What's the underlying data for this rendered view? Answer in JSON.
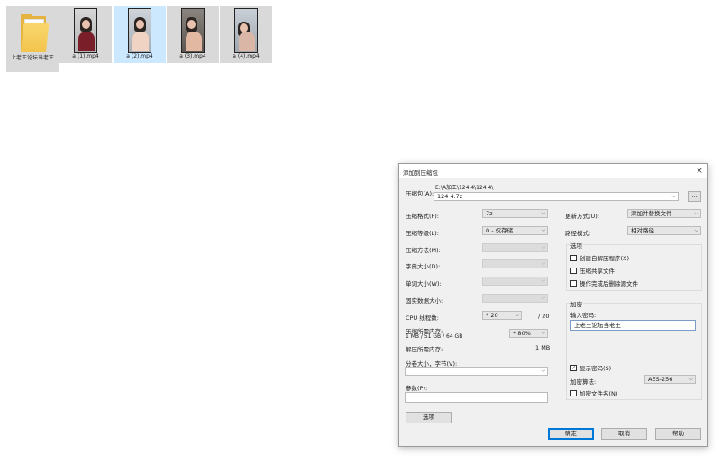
{
  "desktop": {
    "folder": {
      "name": "上老王论坛当老王",
      "icon": "folder-icon"
    },
    "files": [
      {
        "name": "a (1).mp4",
        "selected": false
      },
      {
        "name": "a (2).mp4",
        "selected": true
      },
      {
        "name": "a (3).mp4",
        "selected": false
      },
      {
        "name": "a (4).mp4",
        "selected": false
      }
    ]
  },
  "dialog": {
    "title": "添加到压缩包",
    "close_icon": "×",
    "archive": {
      "label": "压缩包(A):",
      "path": "E:\\A加工\\124 4\\124 4\\",
      "value": "124 4.7z",
      "browse_label": "..."
    },
    "format_label": "压缩格式(F):",
    "format_value": "7z",
    "level_label": "压缩等级(L):",
    "level_value": "0 - 仅存储",
    "method_label": "压缩方法(M):",
    "dict_label": "字典大小(D):",
    "word_label": "单词大小(W):",
    "solid_label": "固实数据大小:",
    "cpu_label": "CPU 线程数:",
    "cpu_value": "* 20",
    "cpu_total": "/ 20",
    "memory_label": "压缩所需内存:",
    "memory_value": "1 MB / 51 GB / 64 GB",
    "memory_percent": "* 80%",
    "decomp_label": "解压所需内存:",
    "decomp_value": "1 MB",
    "split_label": "分卷大小，字节(V):",
    "params_label": "参数(P):",
    "options_button": "选项",
    "update_label": "更新方式(U):",
    "update_value": "添加并替换文件",
    "pathmode_label": "路径模式:",
    "pathmode_value": "相对路径",
    "options_group": {
      "title": "选项",
      "sfx": "创建自解压程序(X)",
      "shared": "压缩共享文件",
      "delete": "操作完成后删除源文件"
    },
    "encryption": {
      "title": "加密",
      "password_label": "输入密码:",
      "password_value": "上老王论坛当老王",
      "show_password": "显示密码(S)",
      "method_label": "加密算法:",
      "method_value": "AES-256",
      "encrypt_names": "加密文件名(N)"
    },
    "ok_button": "确定",
    "cancel_button": "取消",
    "help_button": "帮助",
    "chevron": "⌵",
    "check_mark": "✓"
  }
}
